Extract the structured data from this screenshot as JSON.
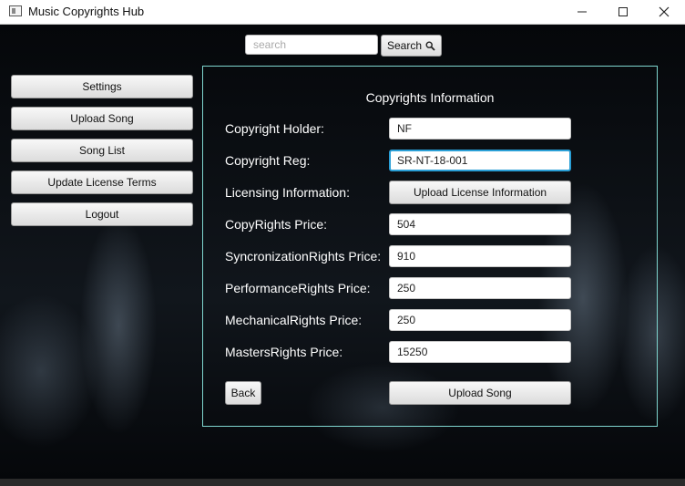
{
  "window": {
    "title": "Music Copyrights Hub"
  },
  "search": {
    "placeholder": "search",
    "button_label": "Search"
  },
  "sidebar": {
    "items": [
      {
        "label": "Settings"
      },
      {
        "label": "Upload Song"
      },
      {
        "label": "Song List"
      },
      {
        "label": "Update License Terms"
      },
      {
        "label": "Logout"
      }
    ]
  },
  "form": {
    "title": "Copyrights Information",
    "fields": [
      {
        "label": "Copyright Holder:",
        "value": "NF"
      },
      {
        "label": "Copyright Reg:",
        "value": "SR-NT-18-001"
      },
      {
        "label": "Licensing Information:",
        "button_label": "Upload License Information"
      },
      {
        "label": "CopyRights Price:",
        "value": "504"
      },
      {
        "label": "SyncronizationRights Price:",
        "value": "910"
      },
      {
        "label": "PerformanceRights Price:",
        "value": "250"
      },
      {
        "label": "MechanicalRights Price:",
        "value": "250"
      },
      {
        "label": "MastersRights Price:",
        "value": "15250"
      }
    ],
    "back_label": "Back",
    "submit_label": "Upload Song"
  },
  "colors": {
    "panel_border": "#7fd6cf",
    "focus_border": "#2a9fd6"
  }
}
